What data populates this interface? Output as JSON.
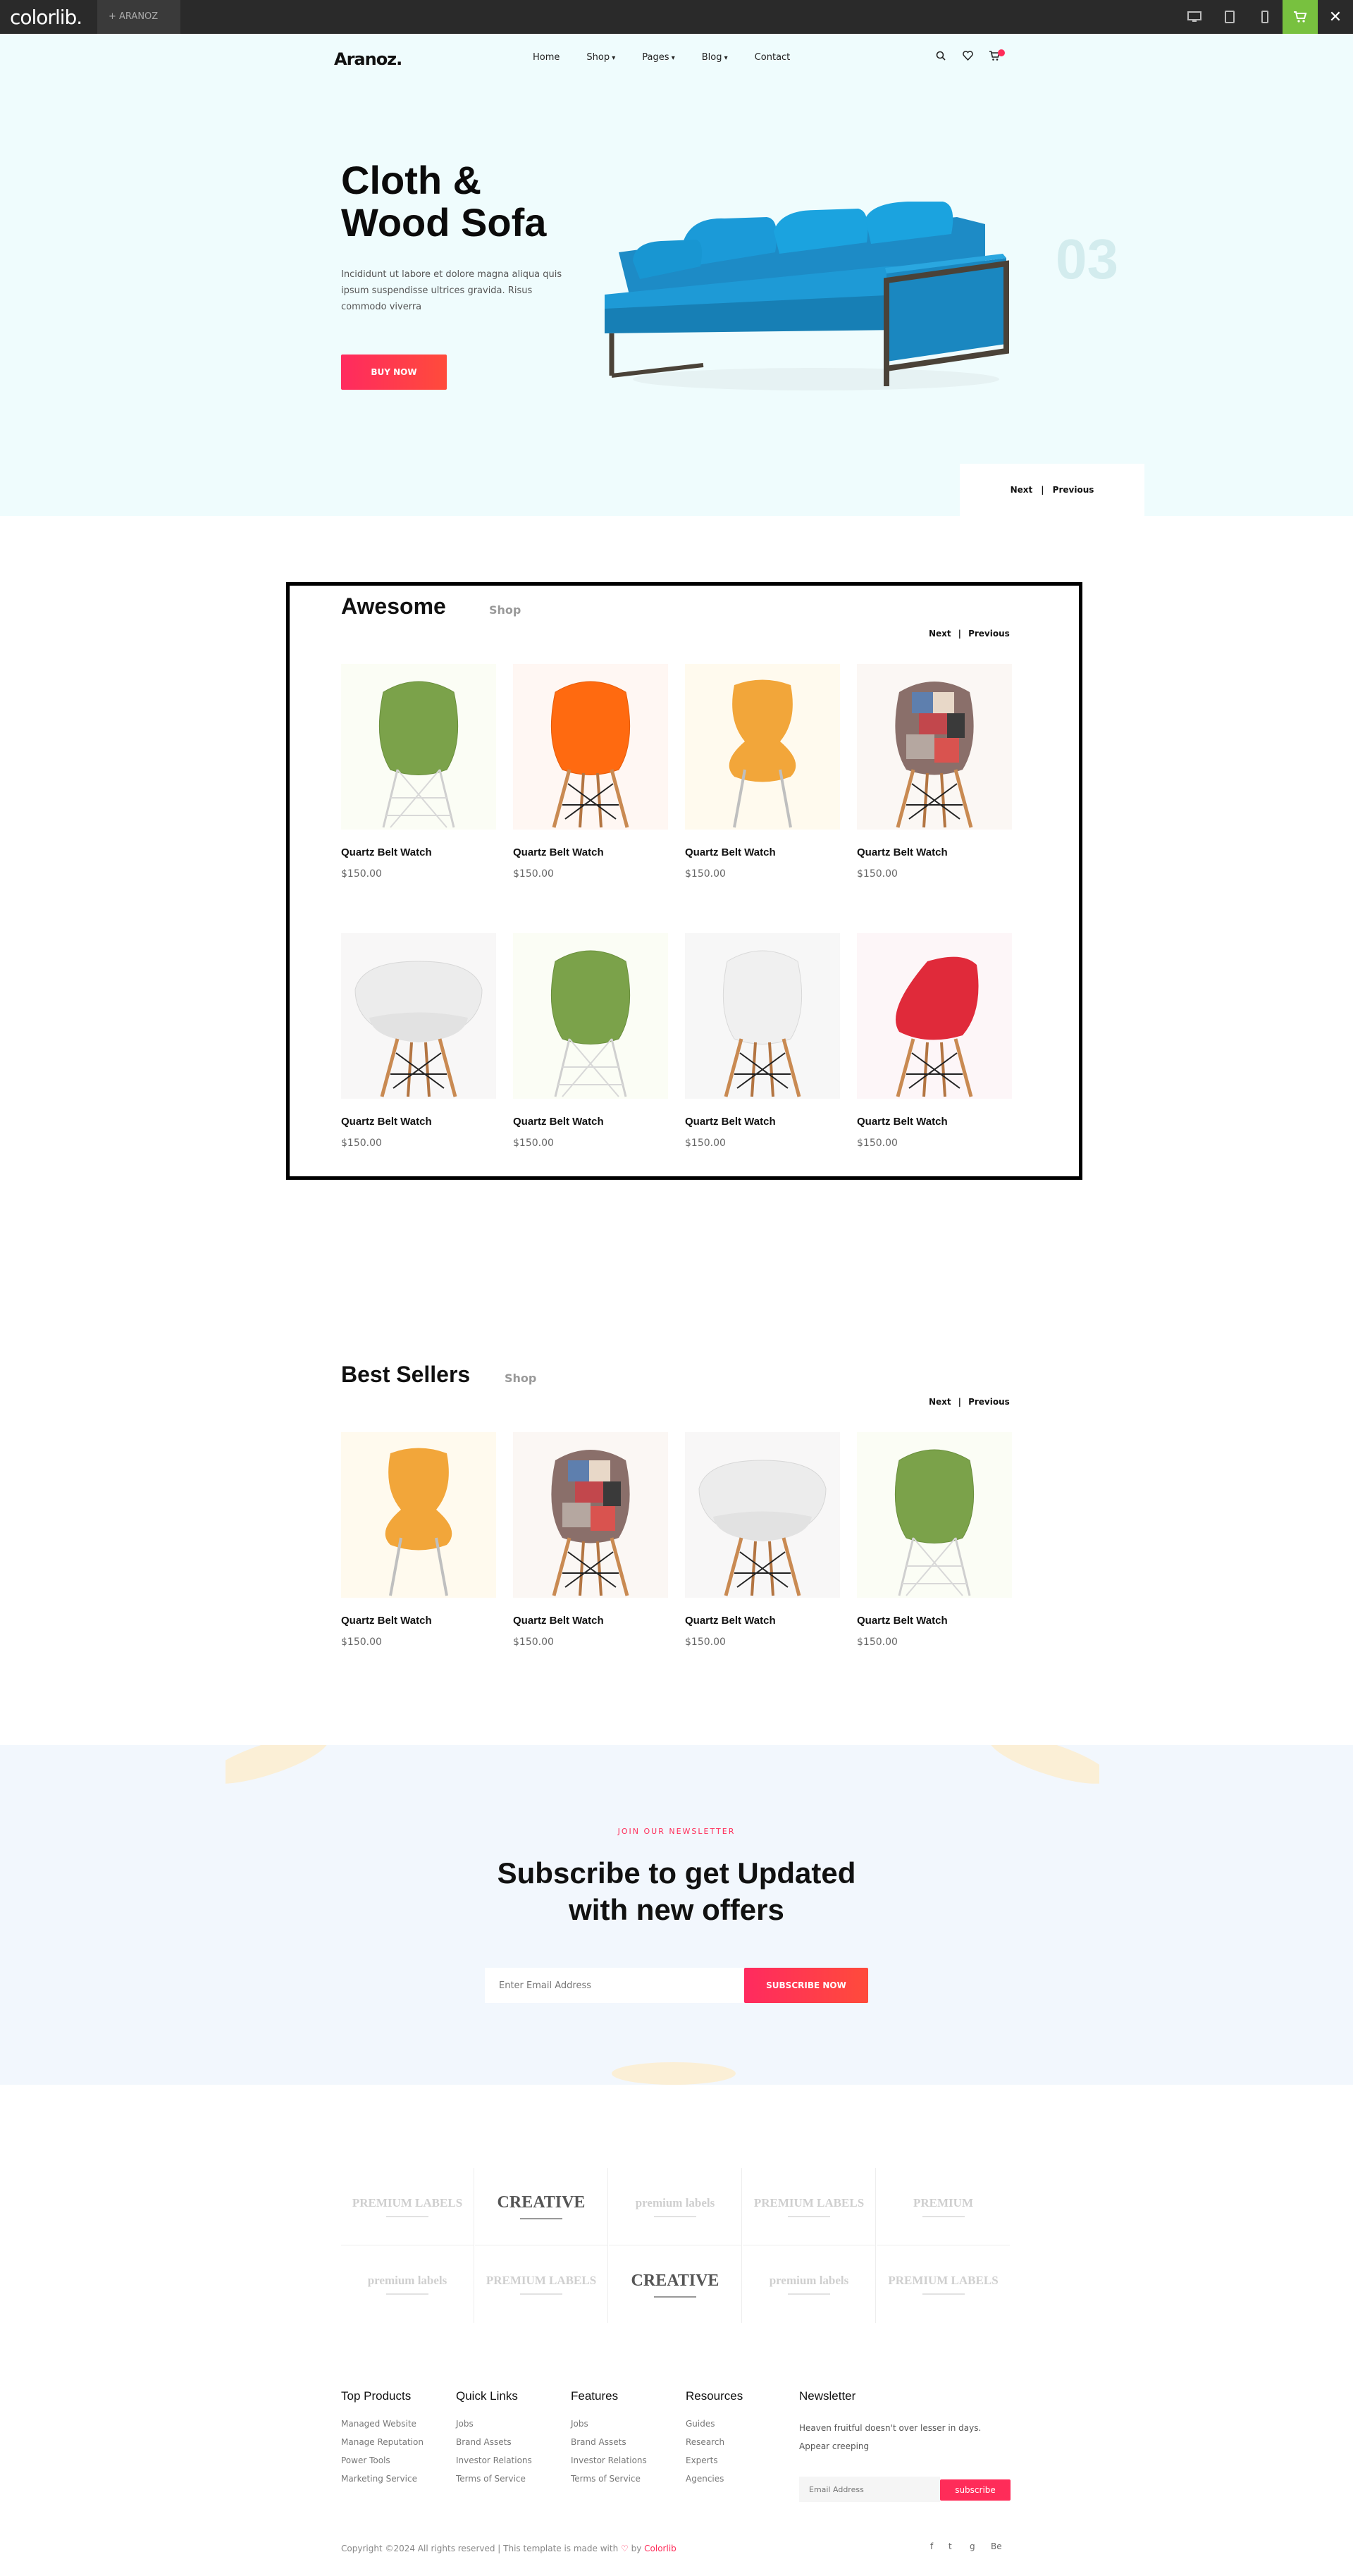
{
  "topbar": {
    "brand": "colorlib.",
    "tab_label": "ARANOZ"
  },
  "header": {
    "logo": "Aranoz.",
    "nav": [
      "Home",
      "Shop",
      "Pages",
      "Blog",
      "Contact"
    ],
    "icons": [
      "search-icon",
      "heart-icon",
      "cart-icon"
    ]
  },
  "hero": {
    "title_line1": "Cloth &",
    "title_line2": "Wood Sofa",
    "text": "Incididunt ut labore et dolore magna aliqua quis ipsum suspendisse ultrices gravida. Risus commodo viverra",
    "button": "BUY NOW",
    "slide_number": "03",
    "next": "Next",
    "separator": "|",
    "previous": "Previous"
  },
  "awesome": {
    "title": "Awesome",
    "subtitle": "Shop",
    "next": "Next",
    "previous": "Previous",
    "products": [
      {
        "name": "Quartz Belt Watch",
        "price": "$150.00",
        "chair": "green-shell-chair"
      },
      {
        "name": "Quartz Belt Watch",
        "price": "$150.00",
        "chair": "orange-shell-chair"
      },
      {
        "name": "Quartz Belt Watch",
        "price": "$150.00",
        "chair": "yellow-bent-chair"
      },
      {
        "name": "Quartz Belt Watch",
        "price": "$150.00",
        "chair": "patchwork-chair"
      },
      {
        "name": "Quartz Belt Watch",
        "price": "$150.00",
        "chair": "white-armchair"
      },
      {
        "name": "Quartz Belt Watch",
        "price": "$150.00",
        "chair": "green-shell-chair"
      },
      {
        "name": "Quartz Belt Watch",
        "price": "$150.00",
        "chair": "white-shell-chair"
      },
      {
        "name": "Quartz Belt Watch",
        "price": "$150.00",
        "chair": "red-shell-chair"
      }
    ]
  },
  "best_sellers": {
    "title": "Best Sellers",
    "subtitle": "Shop",
    "next": "Next",
    "previous": "Previous",
    "products": [
      {
        "name": "Quartz Belt Watch",
        "price": "$150.00",
        "chair": "yellow-bent-chair"
      },
      {
        "name": "Quartz Belt Watch",
        "price": "$150.00",
        "chair": "patchwork-chair"
      },
      {
        "name": "Quartz Belt Watch",
        "price": "$150.00",
        "chair": "white-armchair"
      },
      {
        "name": "Quartz Belt Watch",
        "price": "$150.00",
        "chair": "green-shell-chair"
      }
    ]
  },
  "newsletter": {
    "kicker": "JOIN OUR NEWSLETTER",
    "title_line1": "Subscribe to get Updated",
    "title_line2": "with new offers",
    "placeholder": "Enter Email Address",
    "button": "SUBSCRIBE NOW"
  },
  "brands": [
    {
      "label": "PREMIUM LABELS",
      "dark": false
    },
    {
      "label": "CREATIVE",
      "dark": true
    },
    {
      "label": "premium labels",
      "dark": false
    },
    {
      "label": "PREMIUM LABELS",
      "dark": false
    },
    {
      "label": "PREMIUM",
      "dark": false
    },
    {
      "label": "premium labels",
      "dark": false
    },
    {
      "label": "PREMIUM LABELS",
      "dark": false
    },
    {
      "label": "CREATIVE",
      "dark": true
    },
    {
      "label": "premium labels",
      "dark": false
    },
    {
      "label": "PREMIUM LABELS",
      "dark": false
    }
  ],
  "footer": {
    "columns": [
      {
        "title": "Top Products",
        "links": [
          "Managed Website",
          "Manage Reputation",
          "Power Tools",
          "Marketing Service"
        ]
      },
      {
        "title": "Quick Links",
        "links": [
          "Jobs",
          "Brand Assets",
          "Investor Relations",
          "Terms of Service"
        ]
      },
      {
        "title": "Features",
        "links": [
          "Jobs",
          "Brand Assets",
          "Investor Relations",
          "Terms of Service"
        ]
      },
      {
        "title": "Resources",
        "links": [
          "Guides",
          "Research",
          "Experts",
          "Agencies"
        ]
      }
    ],
    "newsletter_title": "Newsletter",
    "newsletter_text": "Heaven fruitful doesn't over lesser in days. Appear creeping",
    "newsletter_placeholder": "Email Address",
    "newsletter_button": "subscribe",
    "copyright_prefix": "Copyright ©2024 All rights reserved | This template is made with",
    "copyright_by": "by",
    "copyright_link": "Colorlib",
    "social": [
      "f",
      "t",
      "g",
      "Be"
    ]
  },
  "colors": {
    "accent": "#ff2c59",
    "hero_bg": "#effcfd",
    "newsletter_bg": "#f2f7fd",
    "topbar_cart": "#78c13f"
  }
}
